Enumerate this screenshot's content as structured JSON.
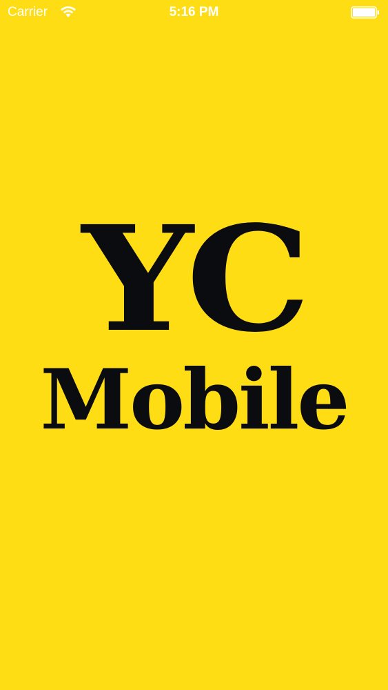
{
  "status_bar": {
    "carrier": "Carrier",
    "time": "5:16 PM",
    "icons": {
      "wifi": "wifi-icon",
      "battery": "battery-icon"
    }
  },
  "splash": {
    "logo_line_1": "YC",
    "logo_line_2": "Mobile"
  },
  "colors": {
    "background": "#FFDD15",
    "logo_text": "#0B0C10",
    "status_text": "#FFFFFF"
  }
}
